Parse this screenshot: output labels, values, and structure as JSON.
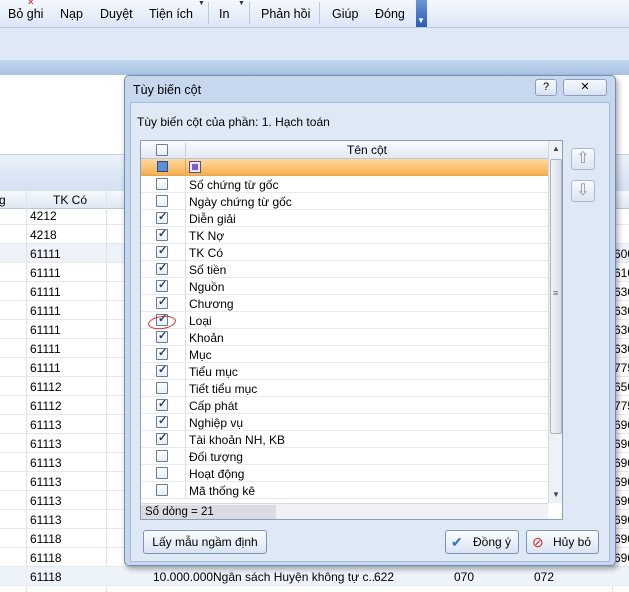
{
  "toolbar": {
    "items": [
      "Bỏ ghi",
      "Nạp",
      "Duyệt",
      "Tiện ích",
      "In",
      "Phản hồi",
      "Giúp",
      "Đóng"
    ]
  },
  "grid": {
    "header": {
      "col1_partial": "g",
      "tk_co": "TK Có"
    },
    "rows": [
      {
        "tk": "4212",
        "right": ""
      },
      {
        "tk": "4218",
        "right": ""
      },
      {
        "tk": "61111",
        "right": "600"
      },
      {
        "tk": "61111",
        "right": "610"
      },
      {
        "tk": "61111",
        "right": "630"
      },
      {
        "tk": "61111",
        "right": "630"
      },
      {
        "tk": "61111",
        "right": "630"
      },
      {
        "tk": "61111",
        "right": "630"
      },
      {
        "tk": "61111",
        "right": "775"
      },
      {
        "tk": "61112",
        "right": "650"
      },
      {
        "tk": "61112",
        "right": "775"
      },
      {
        "tk": "61113",
        "right": "690"
      },
      {
        "tk": "61113",
        "right": "690"
      },
      {
        "tk": "61113",
        "right": "690"
      },
      {
        "tk": "61113",
        "right": "690"
      },
      {
        "tk": "61113",
        "right": "690"
      },
      {
        "tk": "61113",
        "right": "690"
      },
      {
        "tk": "61118",
        "right": "690"
      },
      {
        "tk": "61118",
        "right": "690"
      }
    ],
    "last_row": {
      "tk": "61118",
      "amount": "10.000.000",
      "desc": "Ngân sách Huyện không tự c...",
      "c1": "622",
      "c2": "070",
      "c3": "072"
    }
  },
  "dialog": {
    "title": "Tùy biến cột",
    "help_label": "?",
    "close_label": "✕",
    "subtitle": "Tùy biến cột của phần: 1. Hạch toán",
    "list_header": "Tên cột",
    "columns": [
      {
        "label": "Số chứng từ gốc",
        "checked": false
      },
      {
        "label": "Ngày chứng từ gốc",
        "checked": false
      },
      {
        "label": "Diễn giải",
        "checked": true
      },
      {
        "label": "TK Nợ",
        "checked": true
      },
      {
        "label": "TK Có",
        "checked": true
      },
      {
        "label": "Số tiền",
        "checked": true
      },
      {
        "label": "Nguồn",
        "checked": true
      },
      {
        "label": "Chương",
        "checked": true
      },
      {
        "label": "Loại",
        "checked": true
      },
      {
        "label": "Khoản",
        "checked": true
      },
      {
        "label": "Mục",
        "checked": true
      },
      {
        "label": "Tiểu mục",
        "checked": true
      },
      {
        "label": "Tiết tiểu mục",
        "checked": false
      },
      {
        "label": "Cấp phát",
        "checked": true
      },
      {
        "label": "Nghiệp vụ",
        "checked": true
      },
      {
        "label": "Tài khoản NH, KB",
        "checked": true
      },
      {
        "label": "Đối tượng",
        "checked": false
      },
      {
        "label": "Hoạt động",
        "checked": false
      },
      {
        "label": "Mã thống kê",
        "checked": false
      }
    ],
    "row_count": "Số dòng = 21",
    "move_up_icon": "arrow-up-icon",
    "move_down_icon": "arrow-down-icon",
    "default_button": "Lấy mẫu ngầm định",
    "ok_button": "Đồng ý",
    "cancel_button": "Hủy bỏ"
  },
  "colors": {
    "filter_row": "#f5b04f",
    "dialog_bg": "#c7d8ee",
    "annotation_red": "#d8261f"
  }
}
